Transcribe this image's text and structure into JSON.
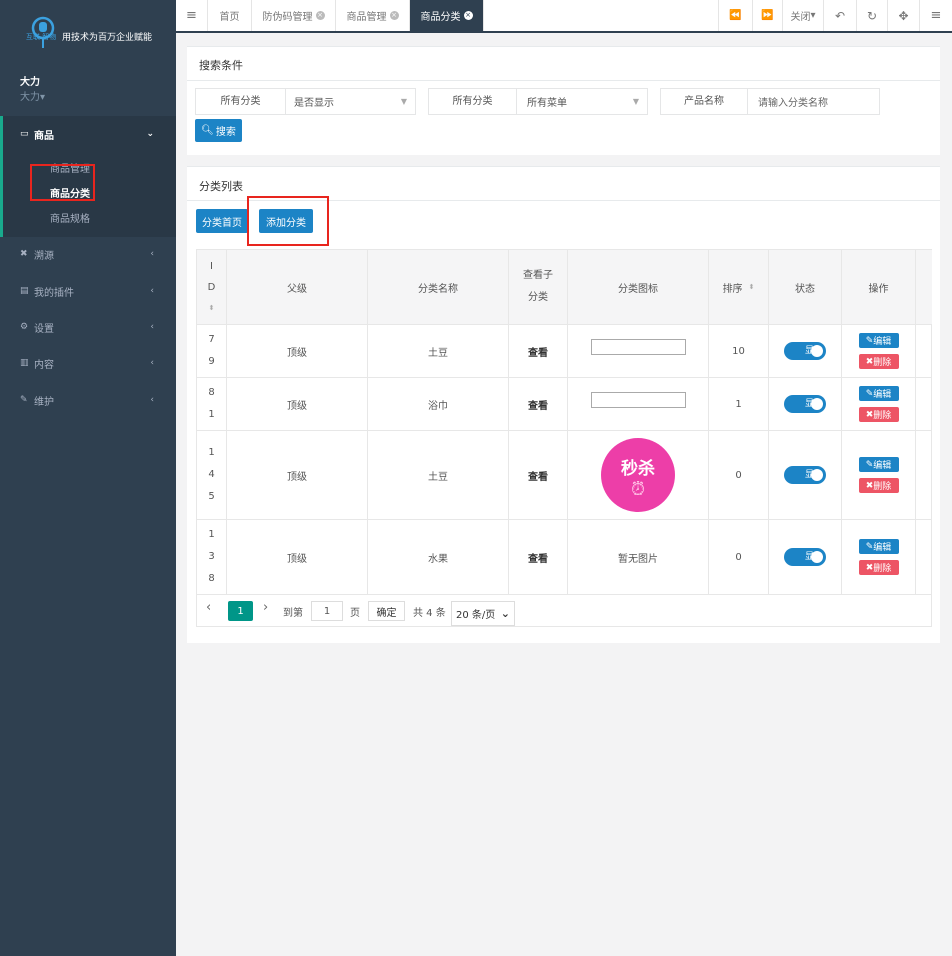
{
  "sidebar": {
    "logo_sub": "互联 智物",
    "logo_text": "用技术为百万企业赋能",
    "user_name": "大力",
    "user_role": "大力▾",
    "menu": [
      {
        "label": "商品",
        "icon": "laptop-icon"
      },
      {
        "label": "溯源",
        "icon": "cross-icon"
      },
      {
        "label": "我的插件",
        "icon": "keyboard-icon"
      },
      {
        "label": "设置",
        "icon": "gear-icon"
      },
      {
        "label": "内容",
        "icon": "book-icon"
      },
      {
        "label": "维护",
        "icon": "wrench-icon"
      }
    ],
    "submenu": [
      "商品管理",
      "商品分类",
      "商品规格"
    ]
  },
  "topbar": {
    "tabs": [
      {
        "label": "首页"
      },
      {
        "label": "防伪码管理"
      },
      {
        "label": "商品管理"
      },
      {
        "label": "商品分类"
      }
    ],
    "close_label": "关闭"
  },
  "search": {
    "title": "搜索条件",
    "f1_label": "所有分类",
    "f1_value": "是否显示",
    "f2_label": "所有分类",
    "f2_value": "所有菜单",
    "f3_label": "产品名称",
    "f3_placeholder": "请输入分类名称",
    "button": "搜索"
  },
  "list": {
    "title": "分类列表",
    "btn_home": "分类首页",
    "btn_add": "添加分类",
    "headers": [
      "I D",
      "父级",
      "分类名称",
      "查看子分类",
      "分类图标",
      "排序",
      "状态",
      "操作"
    ],
    "rows": [
      {
        "id": "79",
        "parent": "顶级",
        "name": "土豆",
        "view": "查看",
        "icon": "",
        "sort": "10",
        "status": "显"
      },
      {
        "id": "81",
        "parent": "顶级",
        "name": "浴巾",
        "view": "查看",
        "icon": "",
        "sort": "1",
        "status": "显"
      },
      {
        "id": "145",
        "parent": "顶级",
        "name": "土豆",
        "view": "查看",
        "icon": "秒杀",
        "sort": "0",
        "status": "显"
      },
      {
        "id": "138",
        "parent": "顶级",
        "name": "水果",
        "view": "查看",
        "icon": "暂无图片",
        "sort": "0",
        "status": "显"
      }
    ],
    "edit_label": "编辑",
    "delete_label": "删除"
  },
  "pagination": {
    "current": "1",
    "goto_label": "到第",
    "goto_value": "1",
    "page_label": "页",
    "confirm": "确定",
    "total": "共 4 条",
    "page_size": "20 条/页"
  },
  "colors": {
    "accent": "#1c84c6",
    "sidebar": "#2f4050",
    "danger": "#ed5565",
    "highlight": "#e8251e"
  }
}
